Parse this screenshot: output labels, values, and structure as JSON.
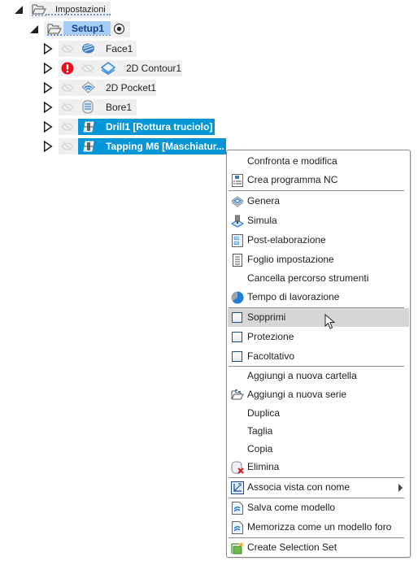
{
  "tree": {
    "root": {
      "label": "Impostazioni",
      "expanded": true
    },
    "setup": {
      "label": "Setup1",
      "expanded": true,
      "active_icon": "radio-dot-icon"
    },
    "operations": [
      {
        "label": "Face1",
        "icon": "face-op-icon",
        "visible": false,
        "error": false,
        "selected": false
      },
      {
        "label": "2D Contour1",
        "icon": "contour-op-icon",
        "visible": false,
        "error": true,
        "selected": false
      },
      {
        "label": "2D Pocket1",
        "icon": "pocket-op-icon",
        "visible": false,
        "error": false,
        "selected": false
      },
      {
        "label": "Bore1",
        "icon": "bore-op-icon",
        "visible": false,
        "error": false,
        "selected": false
      },
      {
        "label": "Drill1 [Rottura truciolo]",
        "icon": "drill-op-icon",
        "visible": false,
        "error": false,
        "selected": true
      },
      {
        "label": "Tapping M6 [Maschiatur...",
        "icon": "drill-op-icon",
        "visible": false,
        "error": false,
        "selected": true
      }
    ]
  },
  "context_menu": {
    "items": [
      {
        "label": "Confronta e modifica",
        "icon": ""
      },
      {
        "label": "Crea programma NC",
        "icon": "nc-program-icon"
      },
      {
        "label": "Genera",
        "icon": "generate-icon"
      },
      {
        "label": "Simula",
        "icon": "simulate-icon"
      },
      {
        "label": "Post-elaborazione",
        "icon": "post-process-icon"
      },
      {
        "label": "Foglio impostazione",
        "icon": "setup-sheet-icon"
      },
      {
        "label": "Cancella percorso strumenti",
        "icon": ""
      },
      {
        "label": "Tempo di lavorazione",
        "icon": "machining-time-icon"
      },
      {
        "label": "Sopprimi",
        "icon": "checkbox-icon",
        "checked": false,
        "hovered": true
      },
      {
        "label": "Protezione",
        "icon": "checkbox-icon",
        "checked": false
      },
      {
        "label": "Facoltativo",
        "icon": "checkbox-icon",
        "checked": false
      },
      {
        "label": "Aggiungi a nuova cartella",
        "icon": ""
      },
      {
        "label": "Aggiungi a nuova serie",
        "icon": "new-pattern-icon"
      },
      {
        "label": "Duplica",
        "icon": ""
      },
      {
        "label": "Taglia",
        "icon": ""
      },
      {
        "label": "Copia",
        "icon": ""
      },
      {
        "label": "Elimina",
        "icon": "delete-icon"
      },
      {
        "label": "Associa vista con nome",
        "icon": "named-view-icon",
        "submenu": true
      },
      {
        "label": "Salva come modello",
        "icon": "template-icon"
      },
      {
        "label": "Memorizza come un modello foro",
        "icon": "template-icon"
      },
      {
        "label": "Create Selection Set",
        "icon": "selection-set-icon"
      }
    ]
  },
  "colors": {
    "selection": "#0696d7",
    "setup_highlight": "#a6cdf7",
    "error": "#e8101f",
    "menu_hover": "#d6d6d6"
  }
}
